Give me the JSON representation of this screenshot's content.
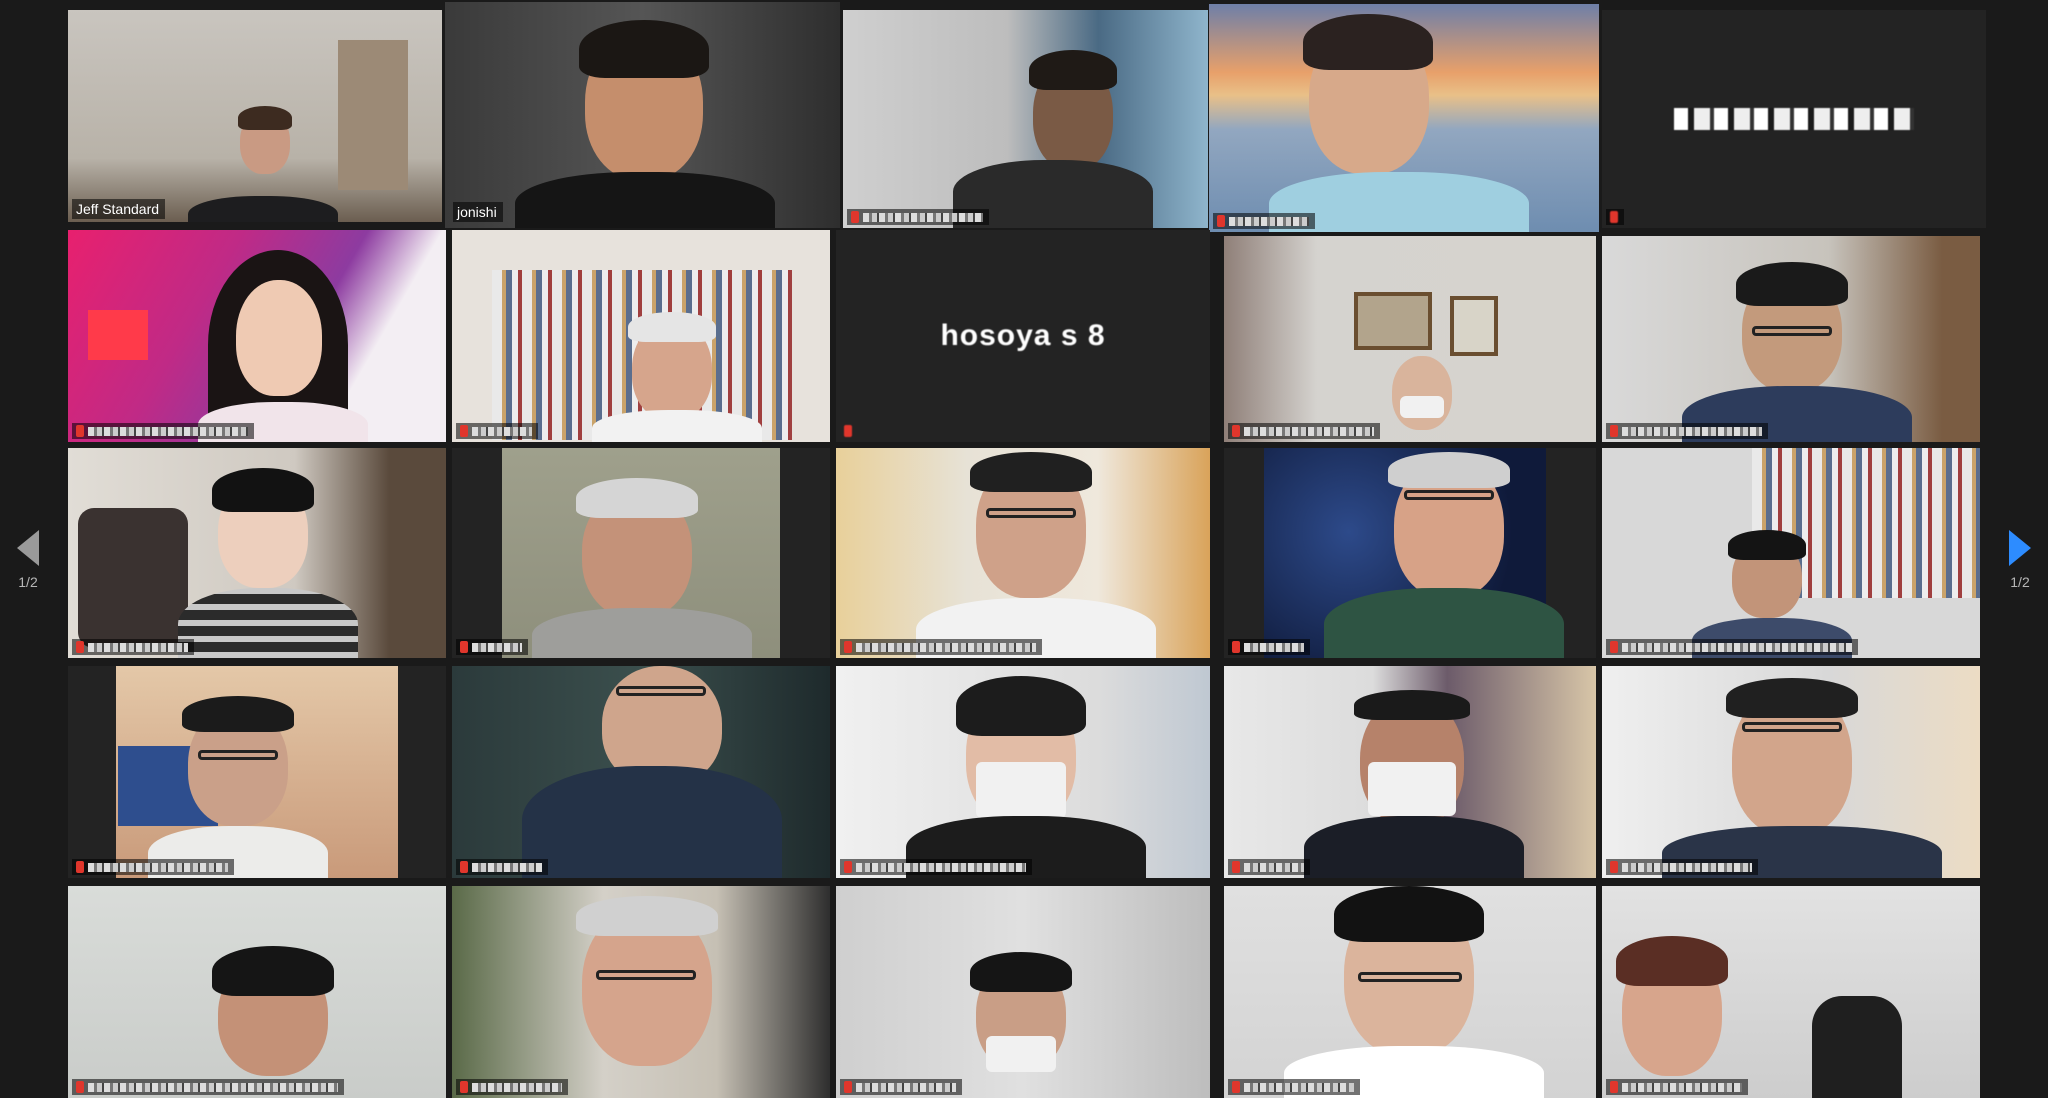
{
  "pagination": {
    "current_page": "1/2"
  },
  "colors": {
    "active_speaker": "#22b14c",
    "spotlight": "#dfe26e",
    "next_arrow": "#2d8cff",
    "muted_icon": "#e0362c"
  },
  "participants": [
    {
      "name": "Jeff Standard",
      "muted": false
    },
    {
      "name": "jonishi",
      "muted": false
    },
    {
      "name": "",
      "muted": true
    },
    {
      "name": "",
      "muted": true
    },
    {
      "name": "",
      "muted": true,
      "display_name_tile": ""
    },
    {
      "name": "",
      "muted": true
    },
    {
      "name": "",
      "muted": true
    },
    {
      "name": "",
      "muted": true,
      "display_name_tile": "hosoya s 8"
    },
    {
      "name": "",
      "muted": true
    },
    {
      "name": "",
      "muted": true
    },
    {
      "name": "",
      "muted": true
    },
    {
      "name": "",
      "muted": true
    },
    {
      "name": "",
      "muted": true
    },
    {
      "name": "",
      "muted": true
    },
    {
      "name": "",
      "muted": true
    },
    {
      "name": "",
      "muted": true
    },
    {
      "name": "",
      "muted": true
    },
    {
      "name": "",
      "muted": true
    },
    {
      "name": "",
      "muted": true
    },
    {
      "name": "",
      "muted": true
    },
    {
      "name": "",
      "muted": true
    },
    {
      "name": "",
      "muted": true
    },
    {
      "name": "",
      "muted": true
    },
    {
      "name": "",
      "muted": true
    },
    {
      "name": "",
      "muted": true
    }
  ]
}
